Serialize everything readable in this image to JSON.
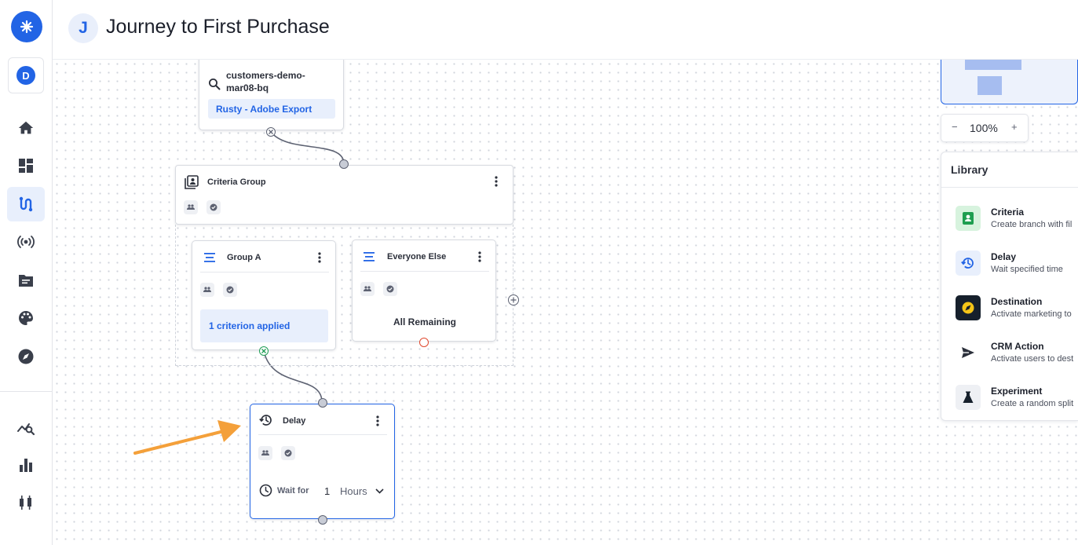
{
  "app": {
    "workspace_initial": "D",
    "accent_color": "#2264e5"
  },
  "nav": {
    "items": [
      {
        "icon": "home-icon"
      },
      {
        "icon": "dashboard-icon"
      },
      {
        "icon": "journeys-icon",
        "active": true
      },
      {
        "icon": "broadcast-icon"
      },
      {
        "icon": "folder-icon"
      },
      {
        "icon": "palette-icon"
      },
      {
        "icon": "compass-icon"
      },
      {
        "icon": "analytics-icon"
      },
      {
        "icon": "bar-chart-icon"
      },
      {
        "icon": "candlestick-icon"
      }
    ]
  },
  "header": {
    "badge_letter": "J",
    "title": "Journey to First Purchase"
  },
  "canvas": {
    "audience_node": {
      "name": "customers-demo-mar08-bq",
      "name_line1": "customers-demo-",
      "name_line2": "mar08-bq",
      "tag": "Rusty - Adobe Export"
    },
    "criteria_group": {
      "title": "Criteria Group"
    },
    "group_a": {
      "title": "Group A",
      "status": "1 criterion applied"
    },
    "everyone_else": {
      "title": "Everyone Else",
      "status": "All Remaining"
    },
    "delay_node": {
      "title": "Delay",
      "wait_label": "Wait for",
      "wait_value": "1",
      "wait_unit": "Hours"
    },
    "arrow_color": "#f4a03a"
  },
  "zoom": {
    "minus": "−",
    "value": "100%",
    "plus": "+"
  },
  "library": {
    "title": "Library",
    "items": [
      {
        "name": "Criteria",
        "desc": "Create branch with fil",
        "icon": "criteria-icon"
      },
      {
        "name": "Delay",
        "desc": "Wait specified time",
        "icon": "delay-icon"
      },
      {
        "name": "Destination",
        "desc": "Activate marketing to",
        "icon": "destination-icon"
      },
      {
        "name": "CRM Action",
        "desc": "Activate users to dest",
        "icon": "send-icon"
      },
      {
        "name": "Experiment",
        "desc": "Create a random split",
        "icon": "flask-icon"
      }
    ]
  }
}
